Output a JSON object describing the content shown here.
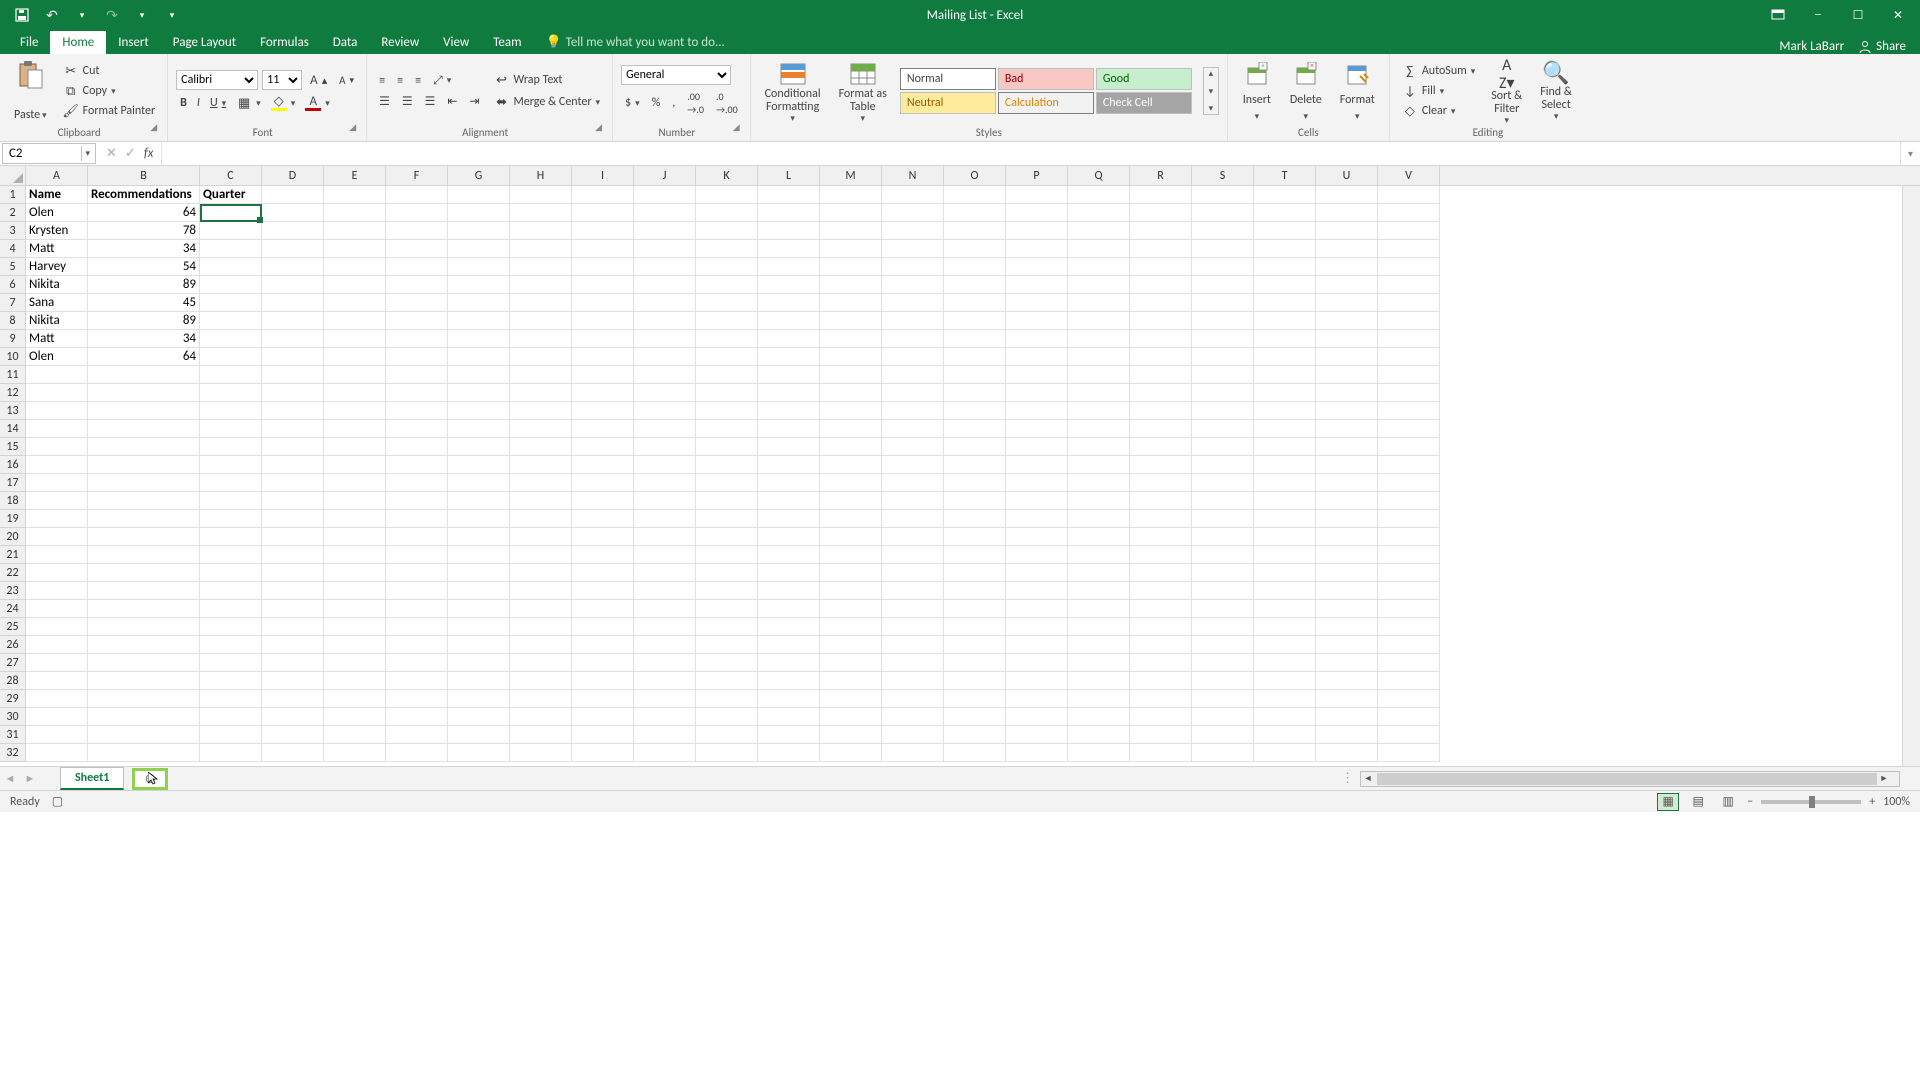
{
  "title": "Mailing List - Excel",
  "user": "Mark LaBarr",
  "share_label": "Share",
  "tabs": {
    "file": "File",
    "home": "Home",
    "insert": "Insert",
    "page_layout": "Page Layout",
    "formulas": "Formulas",
    "data": "Data",
    "review": "Review",
    "view": "View",
    "team": "Team",
    "tell_me": "Tell me what you want to do..."
  },
  "ribbon": {
    "clipboard": {
      "label": "Clipboard",
      "paste": "Paste",
      "cut": "Cut",
      "copy": "Copy",
      "format_painter": "Format Painter"
    },
    "font": {
      "label": "Font",
      "name": "Calibri",
      "size": "11",
      "bold": "B",
      "italic": "I",
      "underline": "U"
    },
    "alignment": {
      "label": "Alignment",
      "wrap": "Wrap Text",
      "merge": "Merge & Center"
    },
    "number": {
      "label": "Number",
      "format": "General"
    },
    "styles": {
      "label": "Styles",
      "cond": "Conditional\nFormatting",
      "table": "Format as\nTable",
      "normal": "Normal",
      "bad": "Bad",
      "good": "Good",
      "neutral": "Neutral",
      "calculation": "Calculation",
      "check_cell": "Check Cell"
    },
    "cells": {
      "label": "Cells",
      "insert": "Insert",
      "delete": "Delete",
      "format": "Format"
    },
    "editing": {
      "label": "Editing",
      "autosum": "AutoSum",
      "fill": "Fill",
      "clear": "Clear",
      "sort": "Sort &\nFilter",
      "find": "Find &\nSelect"
    }
  },
  "namebox": "C2",
  "formula": "",
  "columns": [
    "A",
    "B",
    "C",
    "D",
    "E",
    "F",
    "G",
    "H",
    "I",
    "J",
    "K",
    "L",
    "M",
    "N",
    "O",
    "P",
    "Q",
    "R",
    "S",
    "T",
    "U",
    "V"
  ],
  "row_count": 32,
  "headers": {
    "A": "Name",
    "B": "Recommendations",
    "C": "Quarter"
  },
  "rows": [
    {
      "name": "Olen",
      "rec": 64
    },
    {
      "name": "Krysten",
      "rec": 78
    },
    {
      "name": "Matt",
      "rec": 34
    },
    {
      "name": "Harvey",
      "rec": 54
    },
    {
      "name": "Nikita",
      "rec": 89
    },
    {
      "name": "Sana",
      "rec": 45
    },
    {
      "name": "Nikita",
      "rec": 89
    },
    {
      "name": "Matt",
      "rec": 34
    },
    {
      "name": "Olen",
      "rec": 64
    }
  ],
  "sheet": {
    "active": "Sheet1"
  },
  "status": {
    "ready": "Ready",
    "zoom": "100%"
  }
}
